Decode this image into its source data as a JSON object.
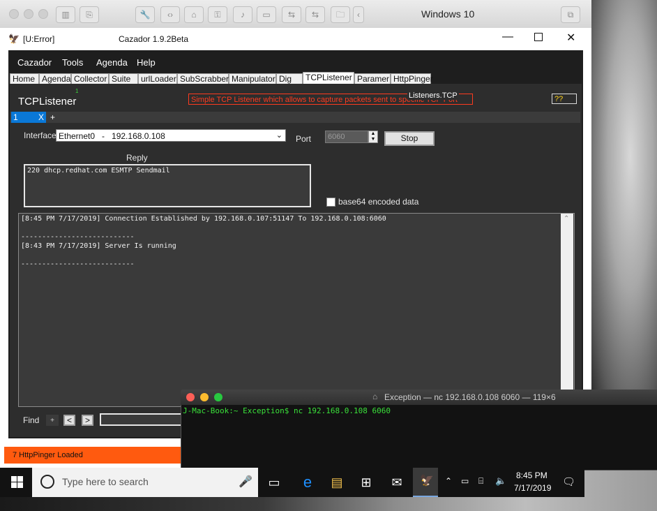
{
  "vm": {
    "title": "Windows 10"
  },
  "app": {
    "title_left": "[U:Error]",
    "title_center": "Cazador 1.9.2Beta",
    "menu": [
      "Cazador",
      "Tools",
      "Agenda",
      "Help"
    ],
    "tabs": [
      "Home",
      "Agenda",
      "Collector",
      "Suite",
      "urlLoader",
      "SubScrabber",
      "Manipulator",
      "Dig",
      "TCPListener",
      "Paramer",
      "HttpPinger"
    ],
    "active_tab": "TCPListener",
    "panel_title": "TCPListener",
    "panel_small_number": "1",
    "banner_overlay": "Listeners.TCP",
    "banner_text": "Simple TCP Listener which allows to capture packets sent to specific TCP Port",
    "help_button": "??",
    "subtab_label": "1",
    "subtab_close": "X",
    "subtab_add": "+",
    "interface_label": "Interface",
    "interface_value": "Ethernet0   -   192.168.0.108",
    "port_label": "Port",
    "port_value": "6060",
    "stop_button": "Stop",
    "reply_label": "Reply",
    "reply_text": "220 dhcp.redhat.com ESMTP Sendmail",
    "base64_label": "base64 encoded data",
    "log_lines": [
      "[8:45 PM 7/17/2019] Connection Established by 192.168.0.107:51147 To 192.168.0.108:6060",
      "",
      "---------------------------",
      "[8:43 PM 7/17/2019] Server Is running",
      "",
      "---------------------------"
    ],
    "find_label": "Find",
    "find_add": "+",
    "find_prev": "<",
    "find_next": ">",
    "status_text": "7 HttpPinger Loaded"
  },
  "terminal": {
    "title": "Exception — nc 192.168.0.108 6060 — 119×6",
    "prompt": "J-Mac-Book:~ Exception$ nc 192.168.0.108 6060"
  },
  "taskbar": {
    "search_placeholder": "Type here to search",
    "time": "8:45 PM",
    "date": "7/17/2019"
  }
}
